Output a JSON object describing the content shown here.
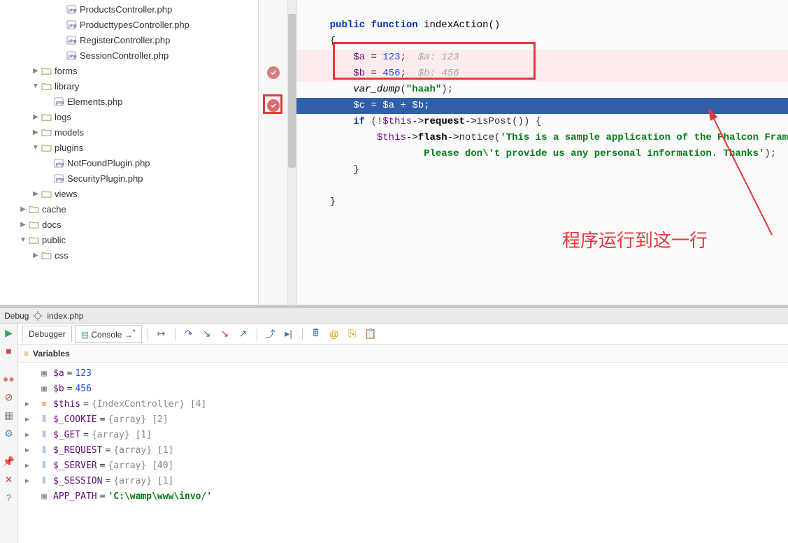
{
  "tree": [
    {
      "indent": 4,
      "type": "file-php",
      "label": "ProductsController.php",
      "arrow": ""
    },
    {
      "indent": 4,
      "type": "file-php",
      "label": "ProducttypesController.php",
      "arrow": ""
    },
    {
      "indent": 4,
      "type": "file-php",
      "label": "RegisterController.php",
      "arrow": ""
    },
    {
      "indent": 4,
      "type": "file-php",
      "label": "SessionController.php",
      "arrow": ""
    },
    {
      "indent": 2,
      "type": "folder",
      "label": "forms",
      "arrow": "▶"
    },
    {
      "indent": 2,
      "type": "folder",
      "label": "library",
      "arrow": "▼"
    },
    {
      "indent": 3,
      "type": "file-php",
      "label": "Elements.php",
      "arrow": ""
    },
    {
      "indent": 2,
      "type": "folder",
      "label": "logs",
      "arrow": "▶"
    },
    {
      "indent": 2,
      "type": "folder",
      "label": "models",
      "arrow": "▶"
    },
    {
      "indent": 2,
      "type": "folder",
      "label": "plugins",
      "arrow": "▼"
    },
    {
      "indent": 3,
      "type": "file-php",
      "label": "NotFoundPlugin.php",
      "arrow": ""
    },
    {
      "indent": 3,
      "type": "file-php",
      "label": "SecurityPlugin.php",
      "arrow": ""
    },
    {
      "indent": 2,
      "type": "folder",
      "label": "views",
      "arrow": "▶"
    },
    {
      "indent": 1,
      "type": "folder",
      "label": "cache",
      "arrow": "▶"
    },
    {
      "indent": 1,
      "type": "folder",
      "label": "docs",
      "arrow": "▶"
    },
    {
      "indent": 1,
      "type": "folder",
      "label": "public",
      "arrow": "▼"
    },
    {
      "indent": 2,
      "type": "folder",
      "label": "css",
      "arrow": "▶"
    }
  ],
  "code": {
    "lines": [
      {
        "cell": "",
        "cls": ""
      },
      {
        "cell": "sig",
        "cls": ""
      },
      {
        "cell": "brace",
        "cls": ""
      },
      {
        "cell": "l1",
        "cls": "hl-highlight"
      },
      {
        "cell": "l2",
        "cls": "hl-highlight"
      },
      {
        "cell": "l3",
        "cls": ""
      },
      {
        "cell": "l4",
        "cls": "hl-current"
      },
      {
        "cell": "l5",
        "cls": ""
      },
      {
        "cell": "l6",
        "cls": ""
      },
      {
        "cell": "l7",
        "cls": ""
      },
      {
        "cell": "l8",
        "cls": ""
      },
      {
        "cell": "l9",
        "cls": ""
      },
      {
        "cell": "l10",
        "cls": ""
      }
    ],
    "sig_public": "public",
    "sig_function": "function",
    "sig_fn": " indexAction()",
    "brace": "    {",
    "l1_var": "$a",
    "l1_num": "123",
    "l1_cm": "$a: 123",
    "l2_var": "$b",
    "l2_num": "456",
    "l2_cm": "$b: 456",
    "l3_fn": "var_dump",
    "l3_str": "\"haah\"",
    "l4_var_c": "$c",
    "l4_var_a": "$a",
    "l4_var_b": "$b",
    "l5_kw": "if",
    "l5_this": "$this",
    "l5_req": "request",
    "l5_isp": "isPost",
    "l6_this": "$this",
    "l6_flash": "flash",
    "l6_notice": "notice",
    "l6_str": "'This is a sample application of the Phalcon Fram",
    "l7_str": "Please don\\'t provide us any personal information. Thanks'",
    "end_brace": "}"
  },
  "annotation": "程序运行到这一行",
  "debug": {
    "title": "Debug",
    "file": "index.php",
    "tab_debugger": "Debugger",
    "tab_console": "Console",
    "vars_title": "Variables",
    "rows": [
      {
        "arrow": "",
        "icon": "box",
        "name": "$a",
        "eq": " = ",
        "val": "123",
        "vcls": "var-val-num"
      },
      {
        "arrow": "",
        "icon": "box",
        "name": "$b",
        "eq": " = ",
        "val": "456",
        "vcls": "var-val-num"
      },
      {
        "arrow": "▶",
        "icon": "eq",
        "name": "$this",
        "eq": " = ",
        "val": "{IndexController} [4]",
        "vcls": "var-val-grey"
      },
      {
        "arrow": "▶",
        "icon": "arr",
        "name": "$_COOKIE",
        "eq": " = ",
        "val": "{array} [2]",
        "vcls": "var-val-grey"
      },
      {
        "arrow": "▶",
        "icon": "arr",
        "name": "$_GET",
        "eq": " = ",
        "val": "{array} [1]",
        "vcls": "var-val-grey"
      },
      {
        "arrow": "▶",
        "icon": "arr",
        "name": "$_REQUEST",
        "eq": " = ",
        "val": "{array} [1]",
        "vcls": "var-val-grey"
      },
      {
        "arrow": "▶",
        "icon": "arr",
        "name": "$_SERVER",
        "eq": " = ",
        "val": "{array} [40]",
        "vcls": "var-val-grey"
      },
      {
        "arrow": "▶",
        "icon": "arr",
        "name": "$_SESSION",
        "eq": " = ",
        "val": "{array} [1]",
        "vcls": "var-val-grey"
      },
      {
        "arrow": "",
        "icon": "box",
        "name": "APP_PATH",
        "eq": " = ",
        "val": "'C:\\wamp\\www\\invo/'",
        "vcls": "var-val-green"
      }
    ]
  }
}
